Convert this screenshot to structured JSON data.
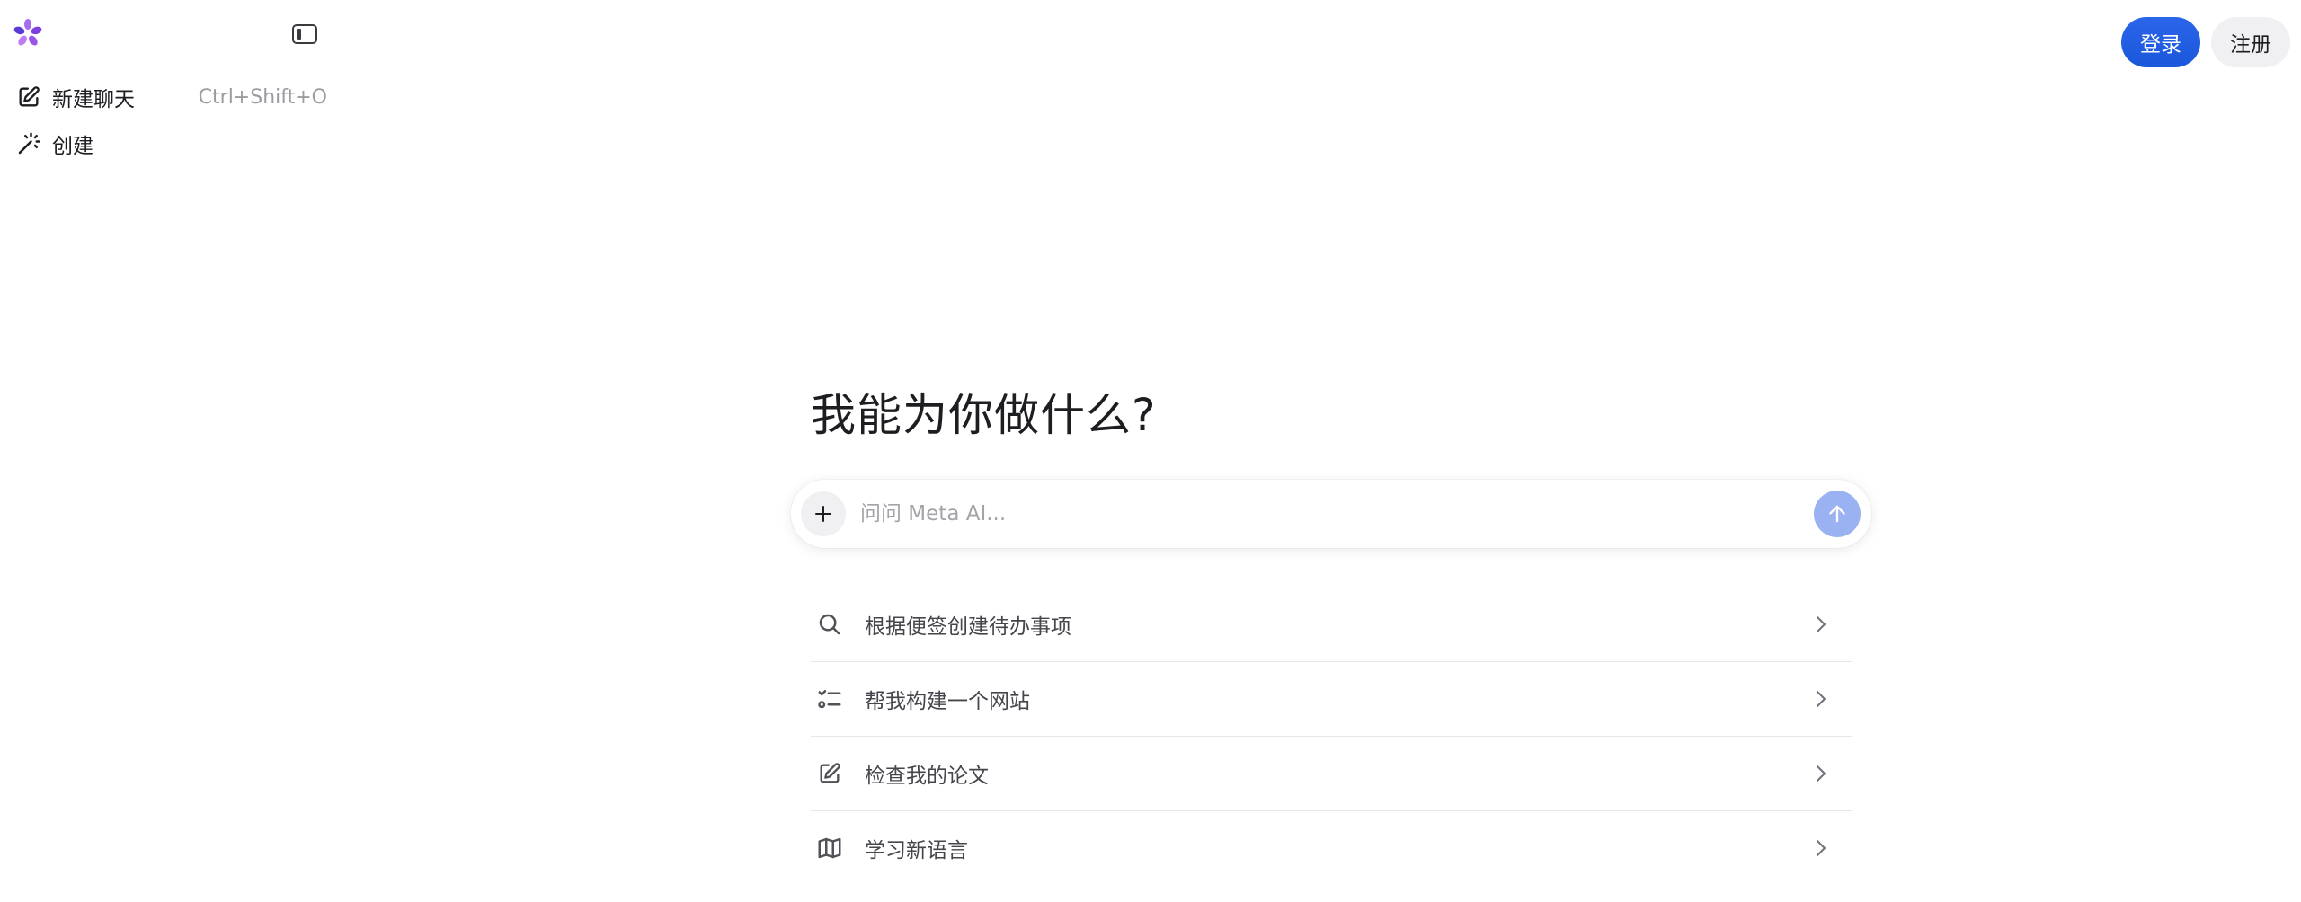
{
  "sidebar": {
    "items": [
      {
        "label": "新建聊天",
        "shortcut": "Ctrl+Shift+O",
        "icon": "edit-icon"
      },
      {
        "label": "创建",
        "icon": "magic-wand-icon"
      }
    ]
  },
  "header": {
    "login_label": "登录",
    "register_label": "注册"
  },
  "main": {
    "headline": "我能为你做什么?",
    "composer": {
      "placeholder": "问问 Meta AI..."
    },
    "suggestions": [
      {
        "label": "根据便签创建待办事项",
        "icon": "search-icon"
      },
      {
        "label": "帮我构建一个网站",
        "icon": "checklist-icon"
      },
      {
        "label": "检查我的论文",
        "icon": "edit-icon"
      },
      {
        "label": "学习新语言",
        "icon": "map-icon"
      }
    ]
  },
  "colors": {
    "accent": "#1f5fe6",
    "send_disabled": "#9bb2f2",
    "logo": "#8a4be0"
  }
}
